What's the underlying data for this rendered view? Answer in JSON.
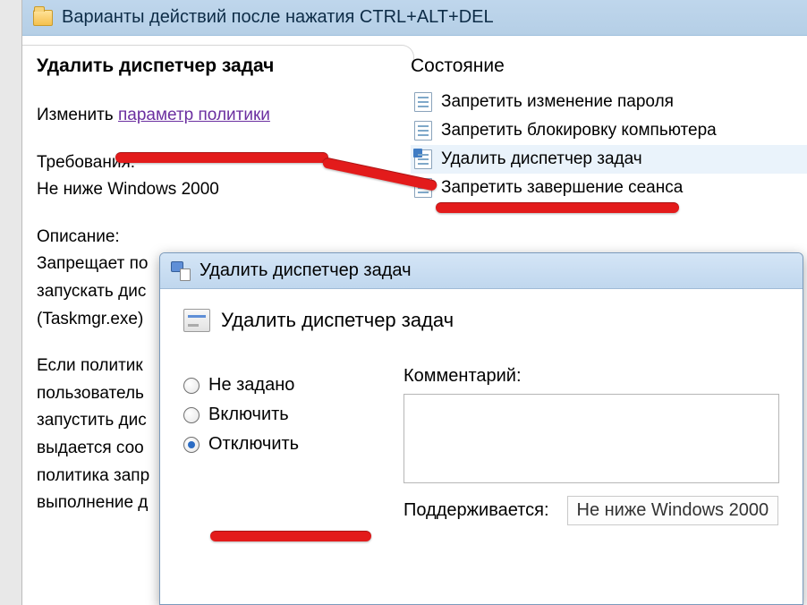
{
  "outer_window": {
    "title": "Варианты действий после нажатия CTRL+ALT+DEL"
  },
  "left": {
    "heading": "Удалить диспетчер задач",
    "change_prefix": "Изменить ",
    "change_link": "параметр политики",
    "req_label": "Требования:",
    "req_value": "Не ниже Windows 2000",
    "desc_label": "Описание:",
    "desc_l1": "Запрещает по",
    "desc_l2": "запускать дис",
    "desc_l3": "(Taskmgr.exe)",
    "desc_l4": "Если политик",
    "desc_l5": "пользователь",
    "desc_l6": "запустить дис",
    "desc_l7": "выдается соо",
    "desc_l8": "политика запр",
    "desc_l9": "выполнение д"
  },
  "right": {
    "heading": "Состояние",
    "items": [
      "Запретить изменение пароля",
      "Запретить блокировку компьютера",
      "Удалить диспетчер задач",
      "Запретить завершение сеанса"
    ]
  },
  "dialog": {
    "title": "Удалить диспетчер задач",
    "heading": "Удалить диспетчер задач",
    "radios": {
      "not_configured": "Не задано",
      "enabled": "Включить",
      "disabled": "Отключить"
    },
    "comment_label": "Комментарий:",
    "supported_label": "Поддерживается:",
    "supported_value": "Не ниже Windows 2000"
  }
}
